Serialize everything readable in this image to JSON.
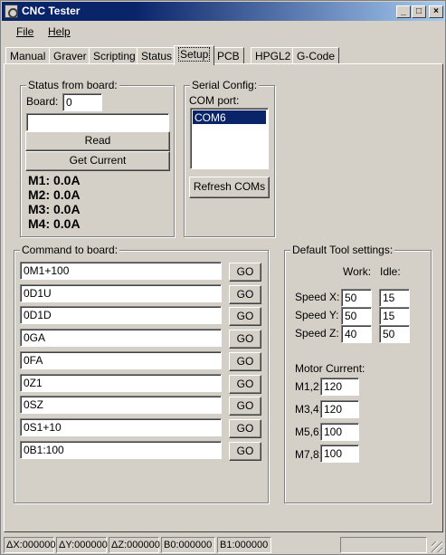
{
  "window": {
    "title": "CNC Tester",
    "icon": "app-icon"
  },
  "menu": {
    "file": "File",
    "help": "Help"
  },
  "tabs": [
    "Manual",
    "Graver",
    "Scripting",
    "Status",
    "Setup",
    "PCB",
    "HPGL2",
    "G-Code"
  ],
  "active_tab": "Setup",
  "status_from_board": {
    "title": "Status from board:",
    "board_label": "Board:",
    "board_value": "0",
    "input_value": "",
    "read_button": "Read",
    "get_current_button": "Get Current",
    "motors": [
      "M1: 0.0A",
      "M2: 0.0A",
      "M3: 0.0A",
      "M4: 0.0A"
    ]
  },
  "serial_config": {
    "title": "Serial Config:",
    "com_label": "COM port:",
    "ports": [
      "COM6"
    ],
    "refresh_button": "Refresh COMs"
  },
  "command_to_board": {
    "title": "Command to board:",
    "go_label": "GO",
    "commands": [
      "0M1+100",
      "0D1U",
      "0D1D",
      "0GA",
      "0FA",
      "0Z1",
      "0SZ",
      "0S1+10",
      "0B1:100"
    ]
  },
  "default_tool": {
    "title": "Default Tool settings:",
    "work_label": "Work:",
    "idle_label": "Idle:",
    "speeds": [
      {
        "label": "Speed X:",
        "work": "50",
        "idle": "15"
      },
      {
        "label": "Speed Y:",
        "work": "50",
        "idle": "15"
      },
      {
        "label": "Speed Z:",
        "work": "40",
        "idle": "50"
      }
    ],
    "motor_current_label": "Motor Current:",
    "currents": [
      {
        "label": "M1,2:",
        "value": "120"
      },
      {
        "label": "M3,4:",
        "value": "120"
      },
      {
        "label": "M5,6:",
        "value": "100"
      },
      {
        "label": "M7,8:",
        "value": "100"
      }
    ]
  },
  "statusbar": [
    "ΔX:000000",
    "ΔY:000000",
    "ΔZ:000000",
    "B0:000000",
    "B1:000000",
    ""
  ]
}
